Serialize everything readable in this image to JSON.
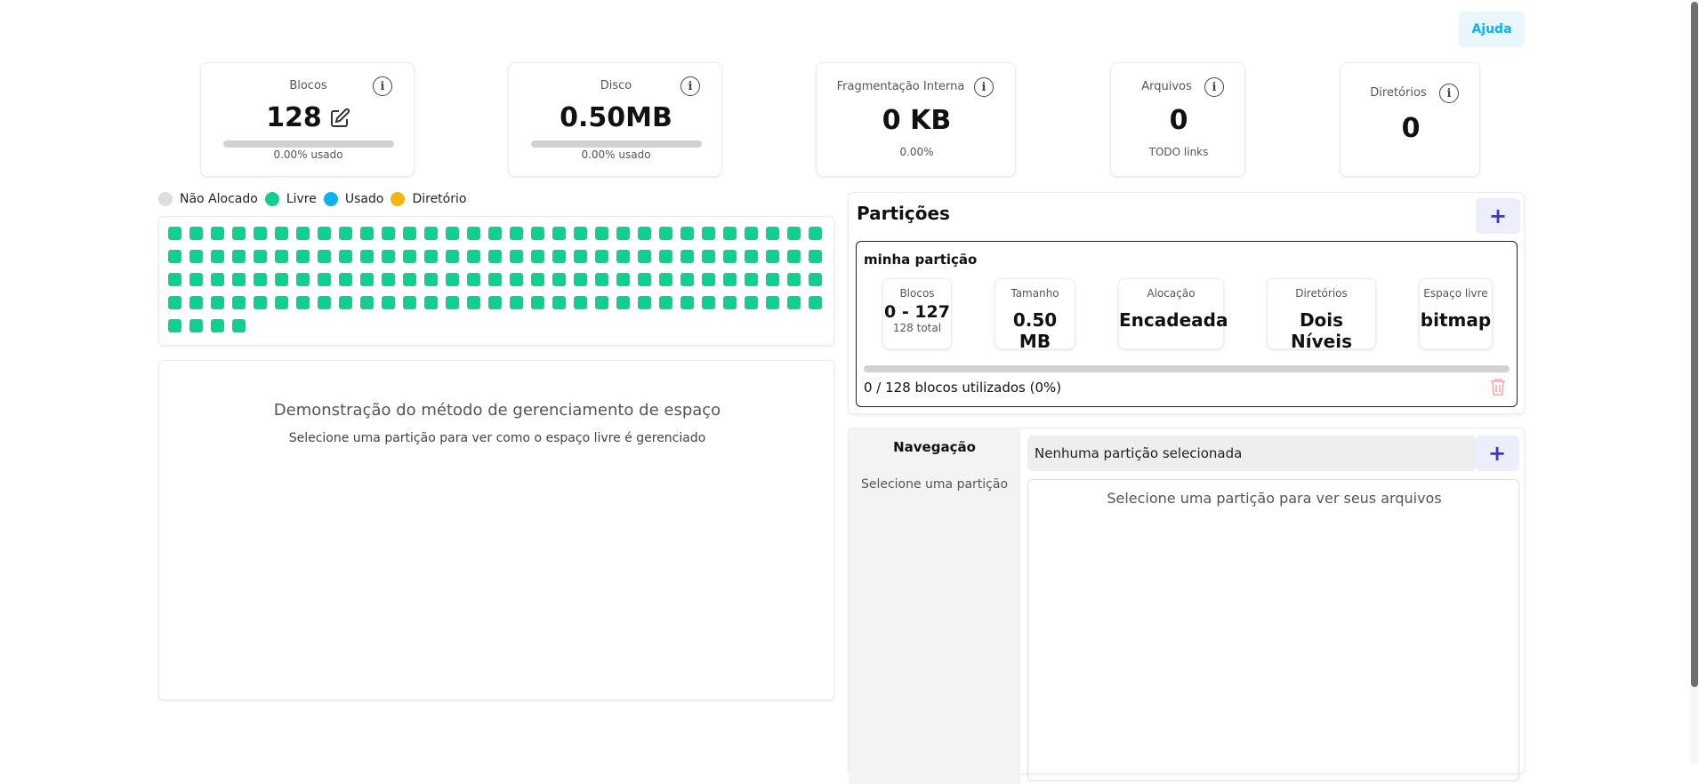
{
  "header": {
    "help_label": "Ajuda"
  },
  "stats": {
    "blocks": {
      "label": "Blocos",
      "value": "128",
      "usage": "0.00% usado",
      "usage_fraction": 0.0
    },
    "disk": {
      "label": "Disco",
      "value": "0.50MB",
      "usage": "0.00% usado",
      "usage_fraction": 0.0
    },
    "fragmentation": {
      "label": "Fragmentação Interna",
      "value": "0 KB",
      "sub": "0.00%"
    },
    "files": {
      "label": "Arquivos",
      "value": "0",
      "sub": "TODO links"
    },
    "directories": {
      "label": "Diretórios",
      "value": "0"
    }
  },
  "legend": [
    {
      "label": "Não Alocado",
      "color": "#dedede"
    },
    {
      "label": "Livre",
      "color": "#10cf8f"
    },
    {
      "label": "Usado",
      "color": "#0ab3f0"
    },
    {
      "label": "Diretório",
      "color": "#f6b50e"
    }
  ],
  "block_map": {
    "total": 128,
    "state": "free",
    "color": "#10cf8f"
  },
  "demo": {
    "title": "Demonstração do método de gerenciamento de espaço",
    "subtitle": "Selecione uma partição para ver como o espaço livre é gerenciado"
  },
  "partitions": {
    "title": "Partições",
    "add_label": "+",
    "items": [
      {
        "name": "minha partição",
        "blocks_label": "Blocos",
        "blocks_value": "0 - 127",
        "blocks_total": "128 total",
        "size_label": "Tamanho",
        "size_value": "0.50 MB",
        "allocation_label": "Alocação",
        "allocation_value": "Encadeada",
        "dirs_label": "Diretórios",
        "dirs_value": "Dois Níveis",
        "free_label": "Espaço livre",
        "free_value": "bitmap",
        "usage_text": "0 / 128 blocos utilizados (0%)",
        "usage_fraction": 0.0,
        "delete_icon": "trash-icon"
      }
    ]
  },
  "navigation": {
    "title": "Navegação",
    "placeholder": "Selecione uma partição"
  },
  "explorer": {
    "path": "Nenhuma partição selecionada",
    "add_label": "+",
    "empty_text": "Selecione uma partição para ver seus arquivos"
  }
}
